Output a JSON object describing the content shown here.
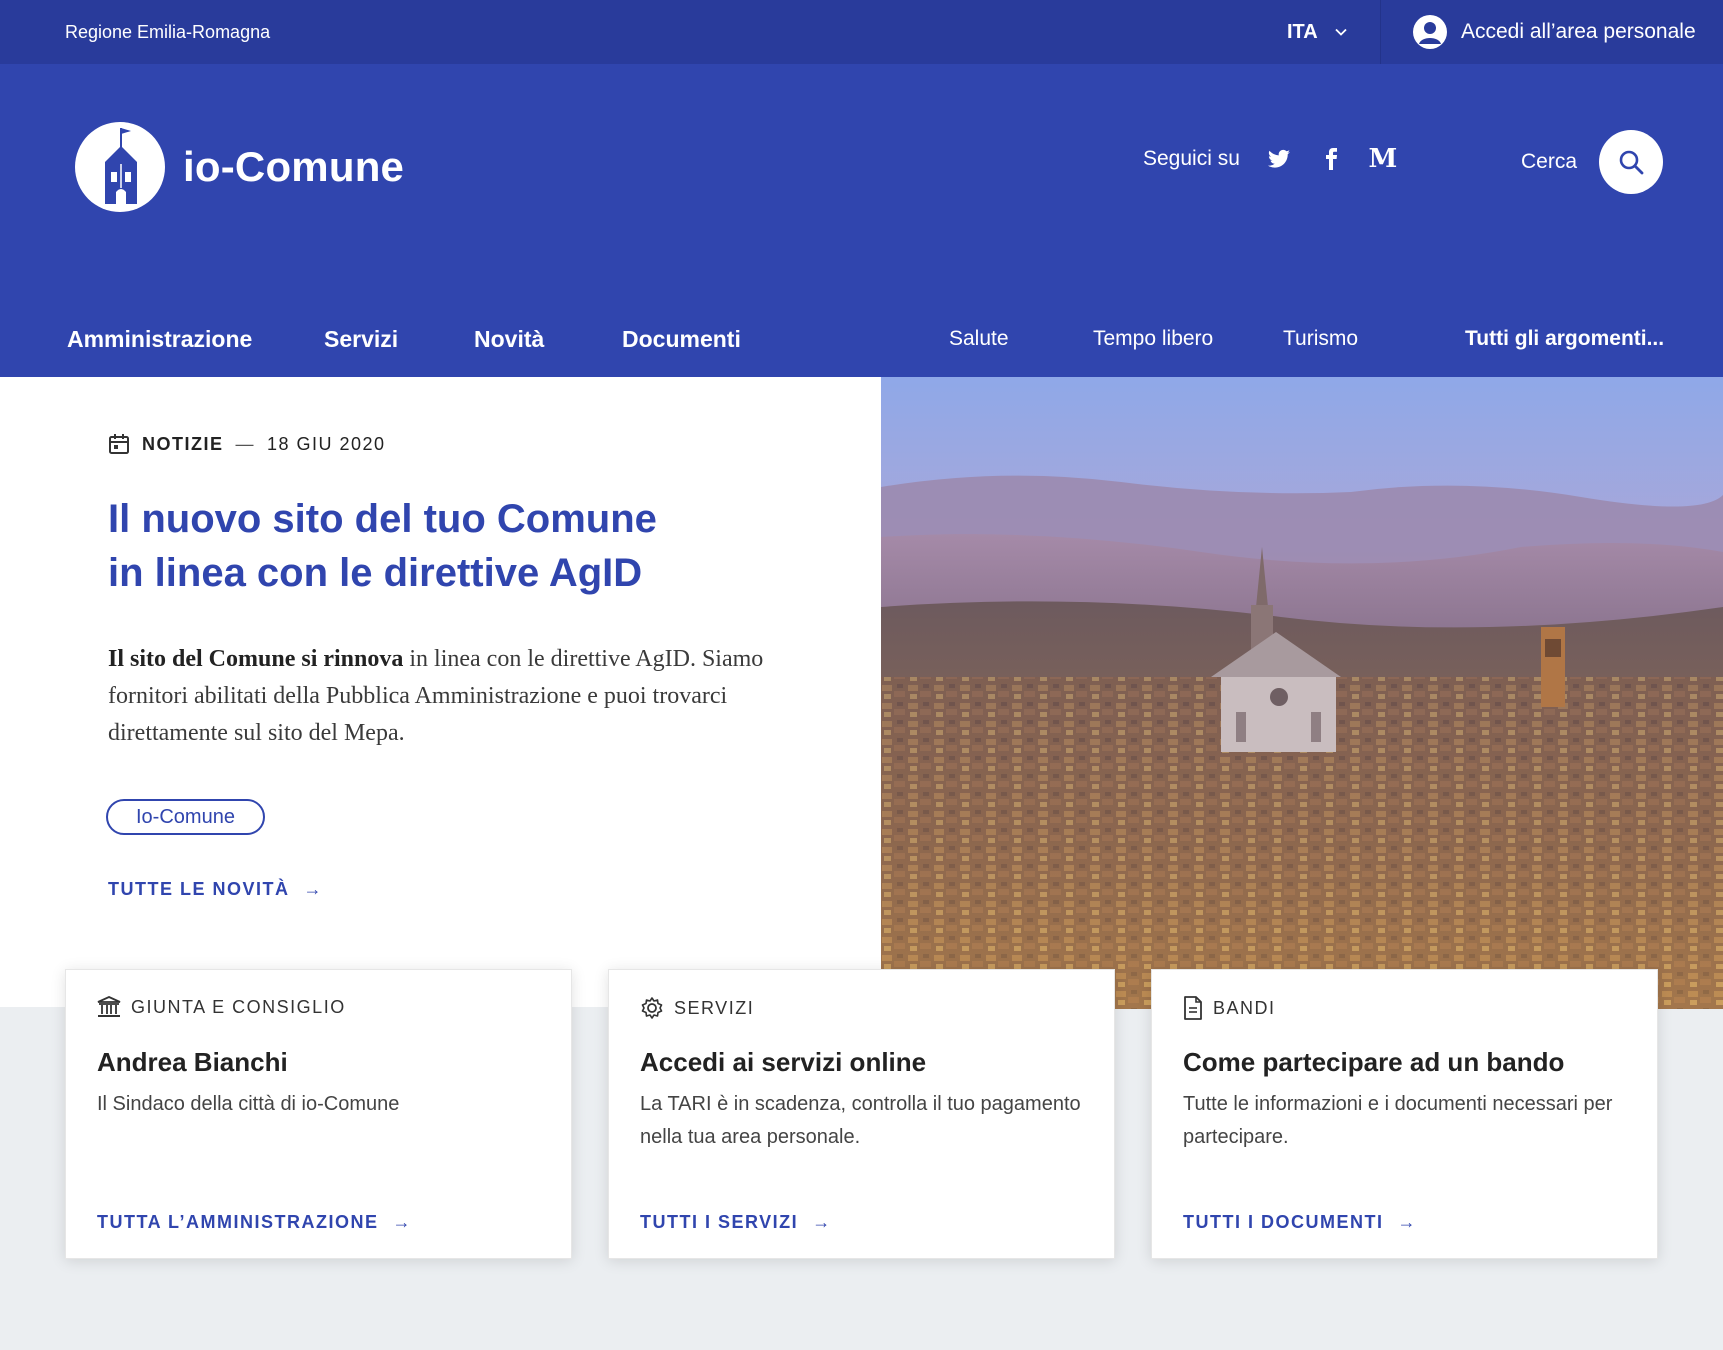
{
  "topbar": {
    "region": "Regione Emilia-Romagna",
    "language": "ITA",
    "login_label": "Accedi all’area personale"
  },
  "header": {
    "site_name": "io-Comune",
    "follow_label": "Seguici su",
    "social": [
      "twitter-icon",
      "facebook-icon",
      "medium-icon"
    ],
    "medium_letter": "M",
    "search_label": "Cerca"
  },
  "nav": {
    "main": [
      "Amministrazione",
      "Servizi",
      "Novità",
      "Documenti"
    ],
    "topics": [
      "Salute",
      "Tempo libero",
      "Turismo"
    ],
    "all_topics": "Tutti gli argomenti..."
  },
  "hero": {
    "category": "NOTIZIE",
    "separator": "—",
    "date": "18 GIU 2020",
    "title_line1": "Il nuovo sito del tuo Comune",
    "title_line2": "in linea con le direttive AgID",
    "lead_bold": "Il sito del Comune si rinnova",
    "lead_rest": " in linea con le direttive AgID. Siamo fornitori abilitati della Pubblica Amministrazione e puoi trovarci direttamente sul sito del Mepa.",
    "tag": "Io-Comune",
    "more_link": "TUTTE LE NOVITÀ",
    "arrow": "→"
  },
  "cards": [
    {
      "kicker": "GIUNTA E CONSIGLIO",
      "icon": "institution-icon",
      "title": "Andrea Bianchi",
      "text": "Il Sindaco della città di io-Comune",
      "link": "TUTTA L’AMMINISTRAZIONE"
    },
    {
      "kicker": "SERVIZI",
      "icon": "gear-icon",
      "title": "Accedi ai servizi online",
      "text": "La TARI è in scadenza, controlla il tuo pagamento nella tua area personale.",
      "link": "TUTTI I SERVIZI"
    },
    {
      "kicker": "BANDI",
      "icon": "document-icon",
      "title": "Come partecipare ad un bando",
      "text": "Tutte le informazioni e i documenti necessari per partecipare.",
      "link": "TUTTI I DOCUMENTI"
    }
  ],
  "colors": {
    "slim_bar": "#293b9b",
    "header": "#3045ae",
    "primary": "#3045ae",
    "page_bg": "#ebeef1"
  }
}
